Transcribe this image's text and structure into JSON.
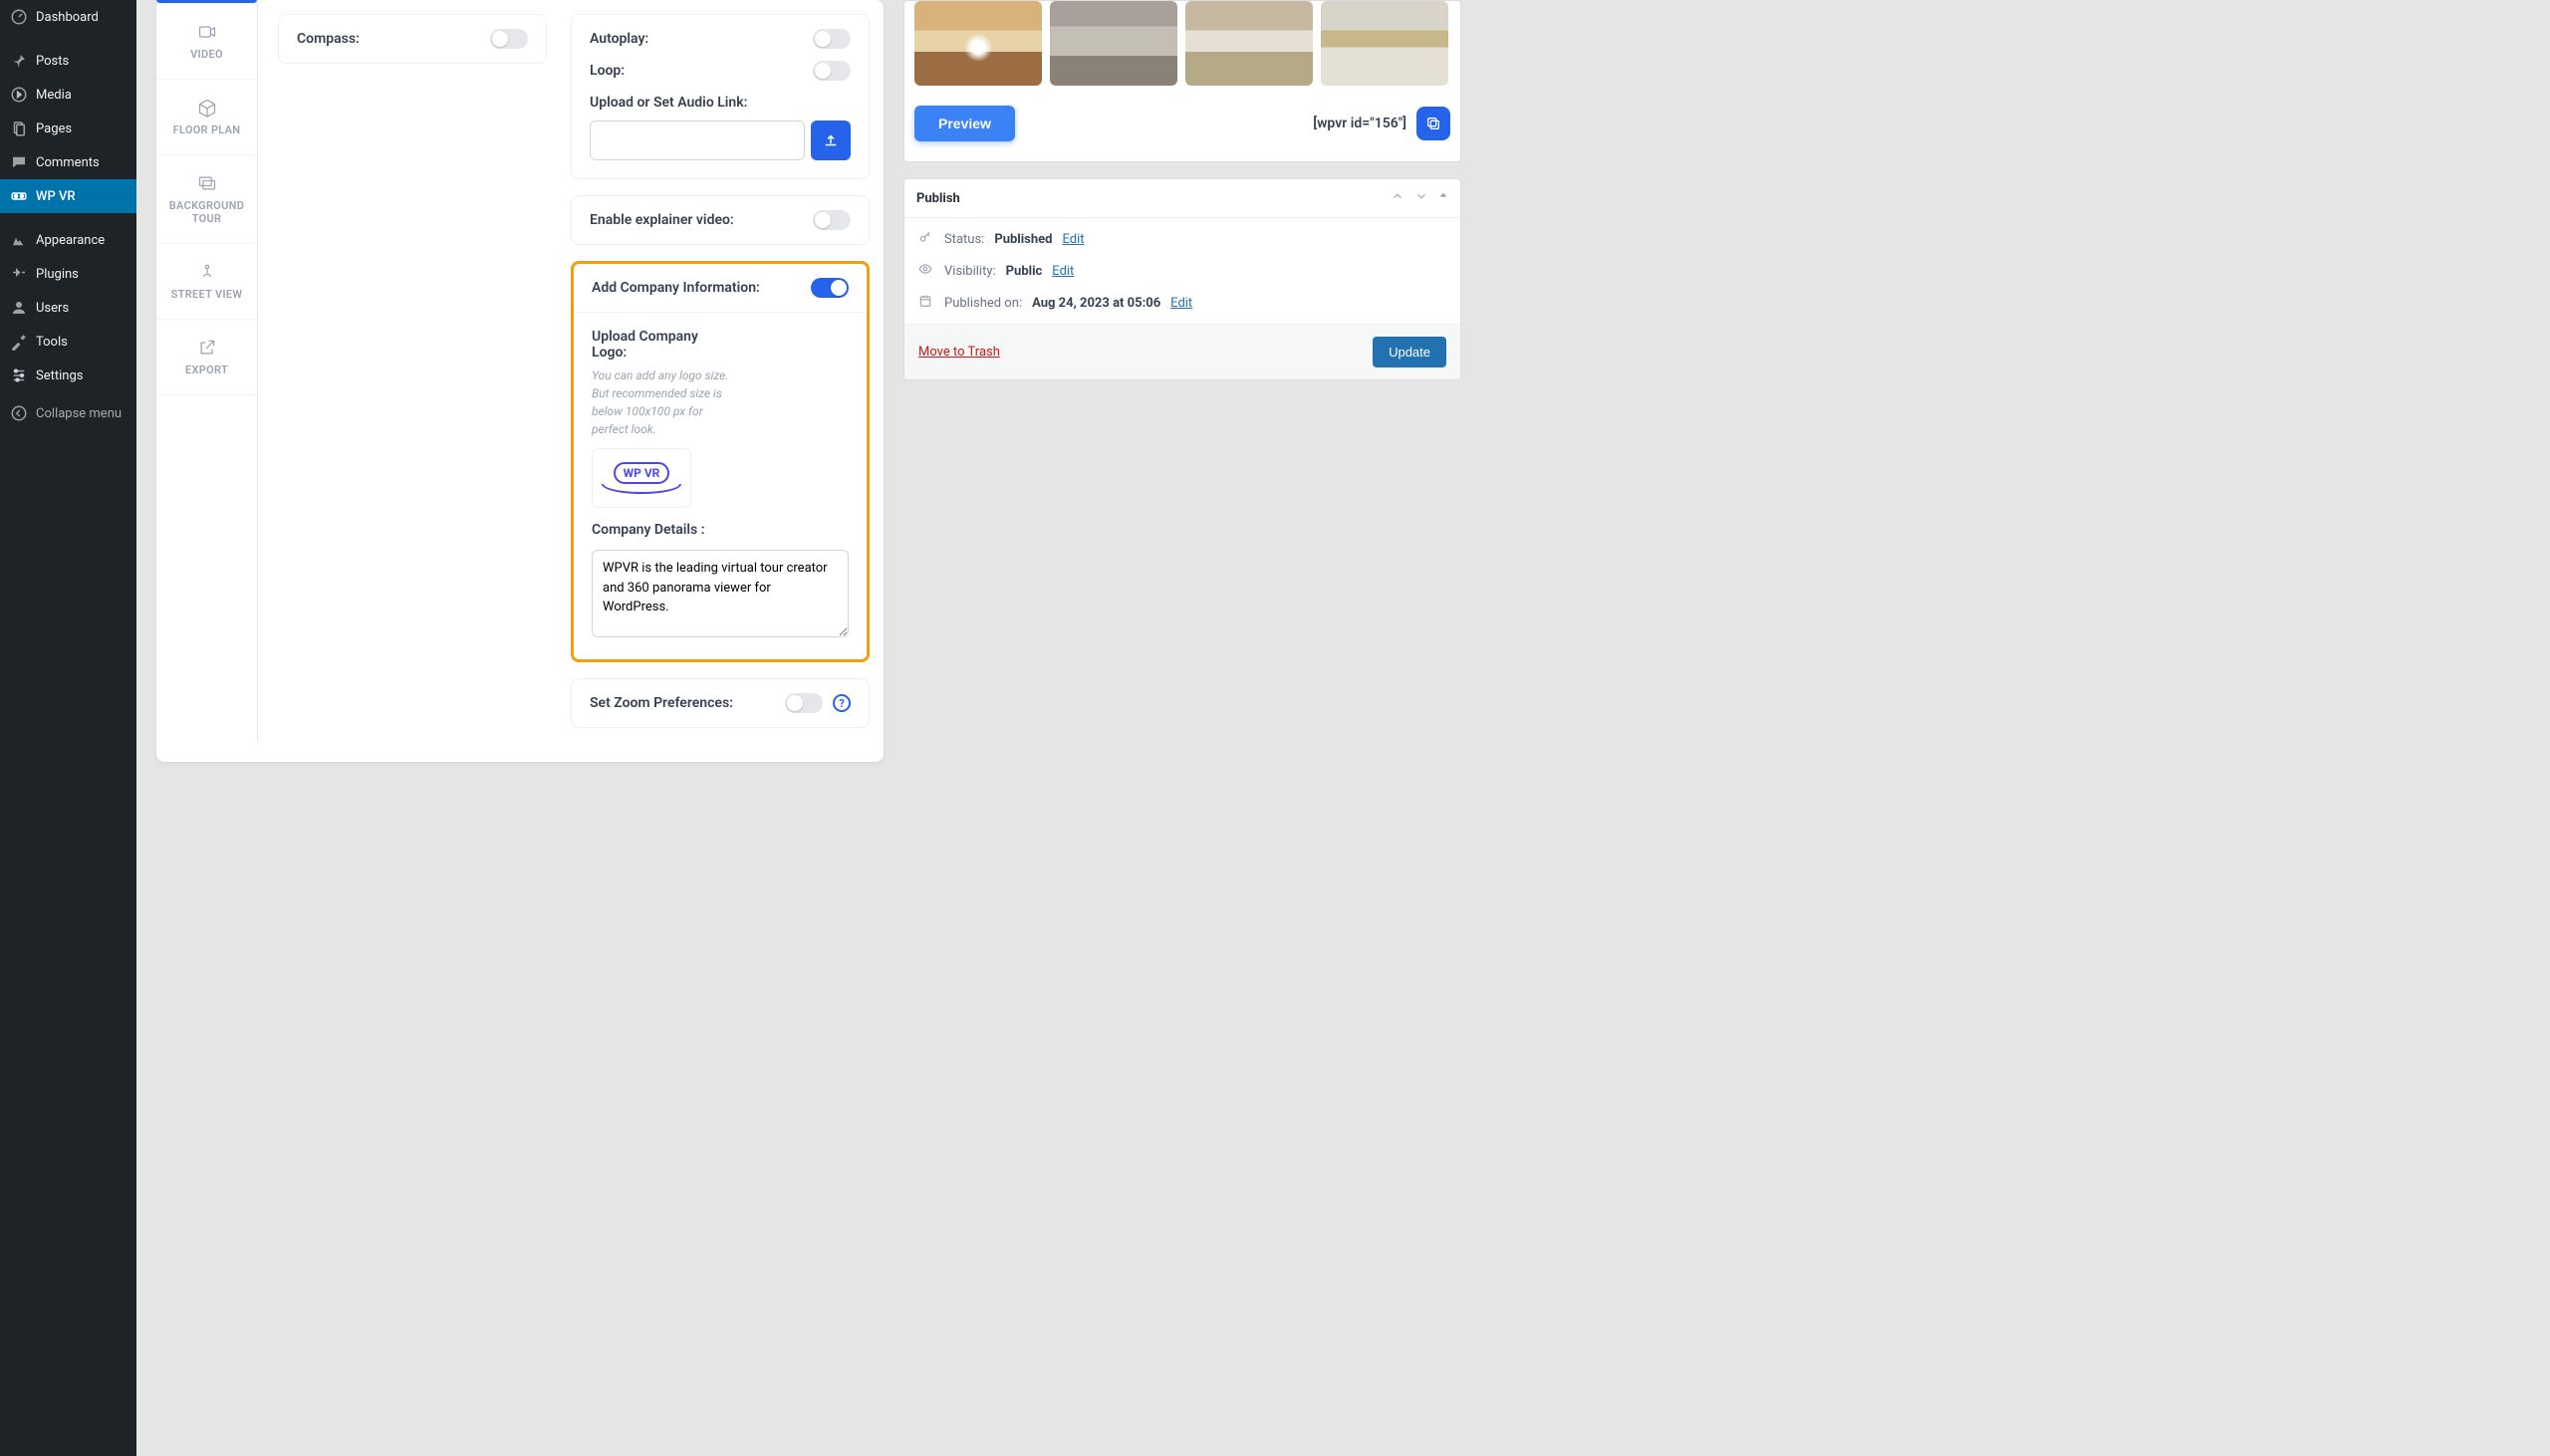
{
  "sidebar": {
    "items": [
      {
        "label": "Dashboard"
      },
      {
        "label": "Posts"
      },
      {
        "label": "Media"
      },
      {
        "label": "Pages"
      },
      {
        "label": "Comments"
      },
      {
        "label": "WP VR"
      },
      {
        "label": "Appearance"
      },
      {
        "label": "Plugins"
      },
      {
        "label": "Users"
      },
      {
        "label": "Tools"
      },
      {
        "label": "Settings"
      },
      {
        "label": "Collapse menu"
      }
    ]
  },
  "vtabs": {
    "video": "VIDEO",
    "floor_plan": "FLOOR PLAN",
    "background_tour": "BACKGROUND TOUR",
    "street_view": "STREET VIEW",
    "export": "EXPORT"
  },
  "left_panel": {
    "compass": "Compass:"
  },
  "right_panel": {
    "autoplay": "Autoplay:",
    "loop": "Loop:",
    "upload_audio": "Upload or Set Audio Link:",
    "audio_value": "",
    "enable_explainer": "Enable explainer video:",
    "company_info": "Add Company Information:",
    "upload_logo": "Upload Company Logo:",
    "logo_hint": "You can add any logo size. But recommended size is below 100x100 px for perfect look.",
    "logo_text": "WP VR",
    "company_details_label": "Company Details :",
    "company_details_value": "WPVR is the leading virtual tour creator and 360 panorama viewer for WordPress.",
    "zoom_pref": "Set Zoom Preferences:"
  },
  "preview": {
    "button": "Preview",
    "shortcode": "[wpvr id=\"156\"]"
  },
  "publish": {
    "title": "Publish",
    "status_label": "Status:",
    "status_value": "Published",
    "status_edit": "Edit",
    "visibility_label": "Visibility:",
    "visibility_value": "Public",
    "visibility_edit": "Edit",
    "published_label": "Published on:",
    "published_value": "Aug 24, 2023 at 05:06",
    "published_edit": "Edit",
    "trash": "Move to Trash",
    "update": "Update"
  }
}
